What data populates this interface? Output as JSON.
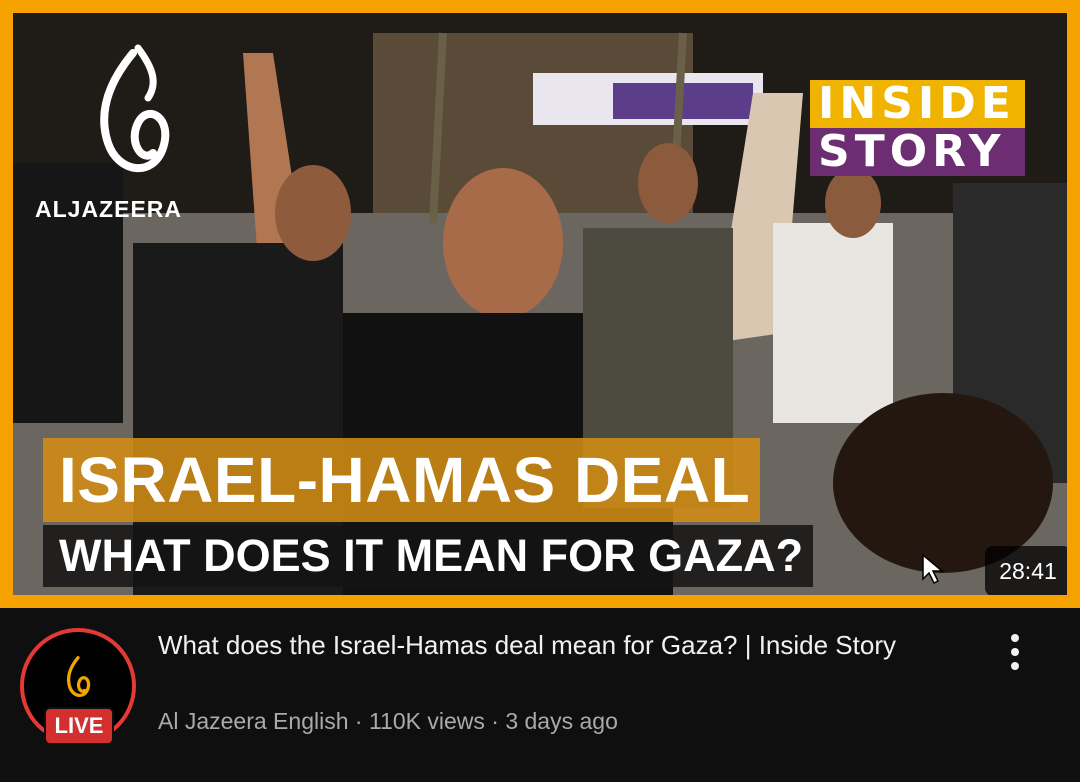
{
  "thumbnail": {
    "channel_logo_text": "ALJAZEERA",
    "badge_line1": "INSIDE",
    "badge_line2": "STORY",
    "headline": "ISRAEL-HAMAS DEAL",
    "subline": "WHAT DOES IT MEAN FOR GAZA?",
    "duration": "28:41",
    "border_color": "#f5a200"
  },
  "video": {
    "title": "What does the Israel-Hamas deal mean for Gaza? |  Inside Story",
    "channel": "Al Jazeera English",
    "views": "110K views",
    "age": "3 days ago"
  },
  "avatar": {
    "live_label": "LIVE",
    "ring_color": "#e53935"
  },
  "menu": {
    "icon": "more-vert-icon"
  }
}
